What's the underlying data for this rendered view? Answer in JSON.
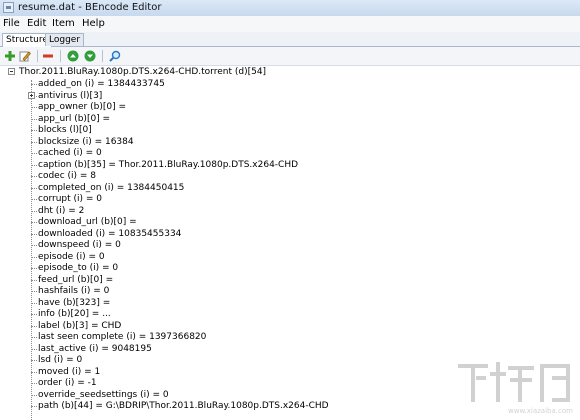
{
  "window": {
    "title": "resume.dat - BEncode Editor"
  },
  "menu": [
    "File",
    "Edit",
    "Item",
    "Help"
  ],
  "tabs": [
    "Structure",
    "Logger"
  ],
  "toolbar": {
    "icons": [
      "add-icon",
      "edit-icon",
      "remove-icon",
      "move-up-icon",
      "move-down-icon",
      "search-icon"
    ],
    "colors": {
      "add": "#3a9a2a",
      "remove": "#d23a2a",
      "move": "#2f9e3b",
      "search": "#2a78c8"
    }
  },
  "tree": {
    "root": "Thor.2011.BluRay.1080p.DTS.x264-CHD.torrent (d)[54]",
    "children": [
      "added_on (i) = 1384433745",
      "antivirus (l)[3]",
      "app_owner (b)[0] =",
      "app_url (b)[0] =",
      "blocks (l)[0]",
      "blocksize (i) = 16384",
      "cached (i) = 0",
      "caption (b)[35] = Thor.2011.BluRay.1080p.DTS.x264-CHD",
      "codec (i) = 8",
      "completed_on (i) = 1384450415",
      "corrupt (i) = 0",
      "dht (i) = 2",
      "download_url (b)[0] =",
      "downloaded (i) = 10835455334",
      "downspeed (i) = 0",
      "episode (i) = 0",
      "episode_to (i) = 0",
      "feed_url (b)[0] =",
      "hashfails (i) = 0",
      "have (b)[323] =",
      "info (b)[20] = ...",
      "label (b)[3] = CHD",
      "last seen complete (i) = 1397366820",
      "last_active (i) = 9048195",
      "lsd (i) = 0",
      "moved (i) = 1",
      "order (i) = -1",
      "override_seedsettings (i) = 0",
      "path (b)[44] = G:\\BDRIP\\Thor.2011.BluRay.1080p.DTS.x264-CHD"
    ],
    "expandable": [
      1
    ]
  },
  "watermark": {
    "text": "下载吧",
    "url": "www.xiazaiba.com"
  }
}
